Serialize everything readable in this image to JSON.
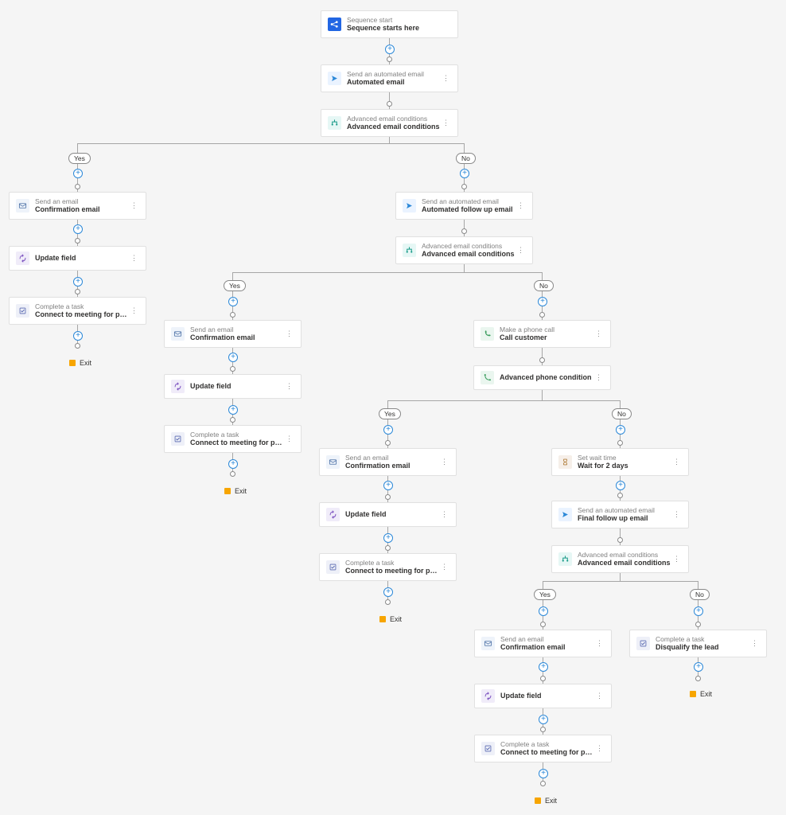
{
  "labels": {
    "yes": "Yes",
    "no": "No",
    "exit": "Exit"
  },
  "n_start": {
    "sub": "Sequence start",
    "title": "Sequence starts here"
  },
  "n_auto1": {
    "sub": "Send an automated email",
    "title": "Automated email"
  },
  "n_cond1": {
    "sub": "Advanced email conditions",
    "title": "Advanced email conditions"
  },
  "n_conf_a": {
    "sub": "Send an email",
    "title": "Confirmation email"
  },
  "n_upd_a": {
    "sub": "",
    "title": "Update field"
  },
  "n_task_a": {
    "sub": "Complete a task",
    "title": "Connect to meeting for product demo r..."
  },
  "n_follow": {
    "sub": "Send an automated email",
    "title": "Automated follow up email"
  },
  "n_cond2": {
    "sub": "Advanced email conditions",
    "title": "Advanced email conditions"
  },
  "n_conf_b": {
    "sub": "Send an email",
    "title": "Confirmation email"
  },
  "n_upd_b": {
    "sub": "",
    "title": "Update field"
  },
  "n_task_b": {
    "sub": "Complete a task",
    "title": "Connect to meeting for product demo r..."
  },
  "n_call": {
    "sub": "Make a phone call",
    "title": "Call customer"
  },
  "n_phcond": {
    "sub": "",
    "title": "Advanced phone condition"
  },
  "n_conf_c": {
    "sub": "Send an email",
    "title": "Confirmation email"
  },
  "n_upd_c": {
    "sub": "",
    "title": "Update field"
  },
  "n_task_c": {
    "sub": "Complete a task",
    "title": "Connect to meeting for product demo r..."
  },
  "n_wait": {
    "sub": "Set wait time",
    "title": "Wait for 2 days"
  },
  "n_final": {
    "sub": "Send an automated email",
    "title": "Final follow up email"
  },
  "n_cond3": {
    "sub": "Advanced email conditions",
    "title": "Advanced email conditions"
  },
  "n_conf_d": {
    "sub": "Send an email",
    "title": "Confirmation email"
  },
  "n_upd_d": {
    "sub": "",
    "title": "Update field"
  },
  "n_task_d": {
    "sub": "Complete a task",
    "title": "Connect to meeting for product demo r..."
  },
  "n_disq": {
    "sub": "Complete a task",
    "title": "Disqualify the lead"
  }
}
